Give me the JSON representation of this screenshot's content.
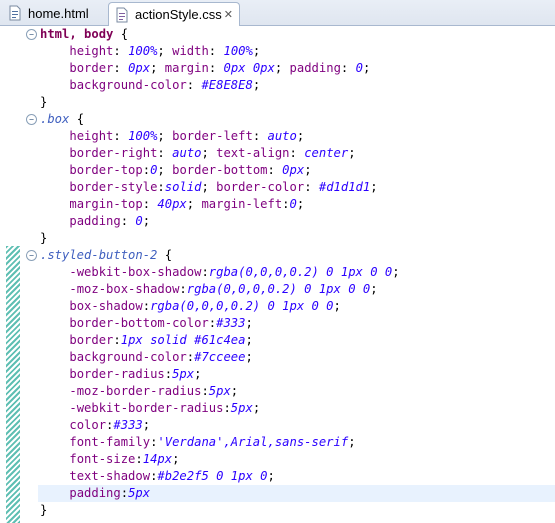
{
  "tabs": [
    {
      "label": "home.html",
      "icon": "html-file-icon",
      "active": false
    },
    {
      "label": "actionStyle.css",
      "icon": "css-file-icon",
      "active": true,
      "close": "✕"
    }
  ],
  "code_lines": [
    {
      "t": "sel",
      "text": "html, body {"
    },
    {
      "t": "decl",
      "prop": "height",
      "val": "100%",
      "rest": "; width: ",
      "val2": "100%",
      "end": ";",
      "prop2": ""
    },
    {
      "t": "raw",
      "text": "    border: 0px; margin: 0px 0px; padding: 0;"
    },
    {
      "t": "raw",
      "text": "    background-color: #E8E8E8;"
    },
    {
      "t": "close",
      "text": "}"
    },
    {
      "t": "sel2",
      "text": ".box {"
    },
    {
      "t": "raw",
      "text": "    height: 100%; border-left: auto;"
    },
    {
      "t": "raw",
      "text": "    border-right: auto; text-align: center;"
    },
    {
      "t": "raw",
      "text": "    border-top:0; border-bottom: 0px;"
    },
    {
      "t": "raw",
      "text": "    border-style:solid; border-color: #d1d1d1;"
    },
    {
      "t": "raw",
      "text": "    margin-top: 40px; margin-left:0;"
    },
    {
      "t": "raw",
      "text": "    padding: 0;"
    },
    {
      "t": "close",
      "text": "}"
    },
    {
      "t": "sel2",
      "text": ".styled-button-2 {"
    },
    {
      "t": "raw",
      "text": "    -webkit-box-shadow:rgba(0,0,0,0.2) 0 1px 0 0;"
    },
    {
      "t": "raw",
      "text": "    -moz-box-shadow:rgba(0,0,0,0.2) 0 1px 0 0;"
    },
    {
      "t": "raw",
      "text": "    box-shadow:rgba(0,0,0,0.2) 0 1px 0 0;"
    },
    {
      "t": "raw",
      "text": "    border-bottom-color:#333;"
    },
    {
      "t": "raw",
      "text": "    border:1px solid #61c4ea;"
    },
    {
      "t": "raw",
      "text": "    background-color:#7cceee;"
    },
    {
      "t": "raw",
      "text": "    border-radius:5px;"
    },
    {
      "t": "raw",
      "text": "    -moz-border-radius:5px;"
    },
    {
      "t": "raw",
      "text": "    -webkit-border-radius:5px;"
    },
    {
      "t": "raw",
      "text": "    color:#333;"
    },
    {
      "t": "raw",
      "text": "    font-family:'Verdana',Arial,sans-serif;"
    },
    {
      "t": "raw",
      "text": "    font-size:14px;"
    },
    {
      "t": "raw",
      "text": "    text-shadow:#b2e2f5 0 1px 0;"
    },
    {
      "t": "raw",
      "text": "    padding:5px"
    },
    {
      "t": "close",
      "text": "}"
    }
  ],
  "colors": {
    "selector": "#7f0055",
    "property": "#7f007f",
    "value": "#2a00ff",
    "changebar": "#5fbfb3",
    "current_line": "#e8f2fe"
  }
}
